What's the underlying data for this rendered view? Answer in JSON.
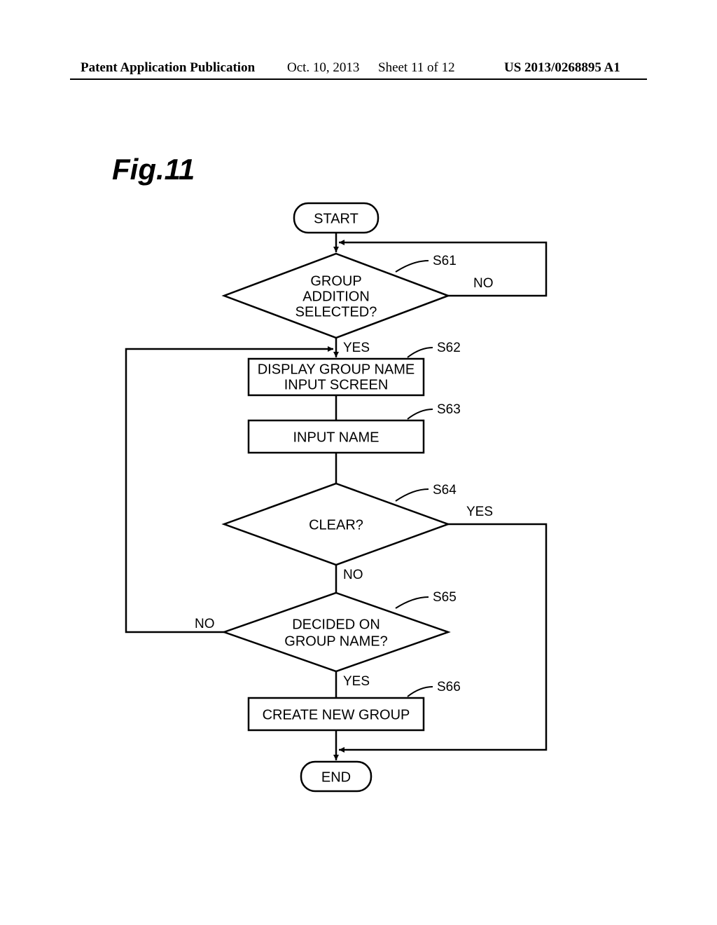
{
  "header": {
    "pub": "Patent Application Publication",
    "date": "Oct. 10, 2013",
    "sheet": "Sheet 11 of 12",
    "pubno": "US 2013/0268895 A1"
  },
  "figure_label": "Fig.11",
  "nodes": {
    "start": "START",
    "end": "END",
    "s61": "GROUP\nADDITION\nSELECTED?",
    "s62": "DISPLAY GROUP NAME\nINPUT SCREEN",
    "s63": "INPUT NAME",
    "s64": "CLEAR?",
    "s65": "DECIDED ON\nGROUP NAME?",
    "s66": "CREATE NEW GROUP"
  },
  "step_labels": {
    "s61": "S61",
    "s62": "S62",
    "s63": "S63",
    "s64": "S64",
    "s65": "S65",
    "s66": "S66"
  },
  "branch_labels": {
    "yes": "YES",
    "no": "NO"
  }
}
